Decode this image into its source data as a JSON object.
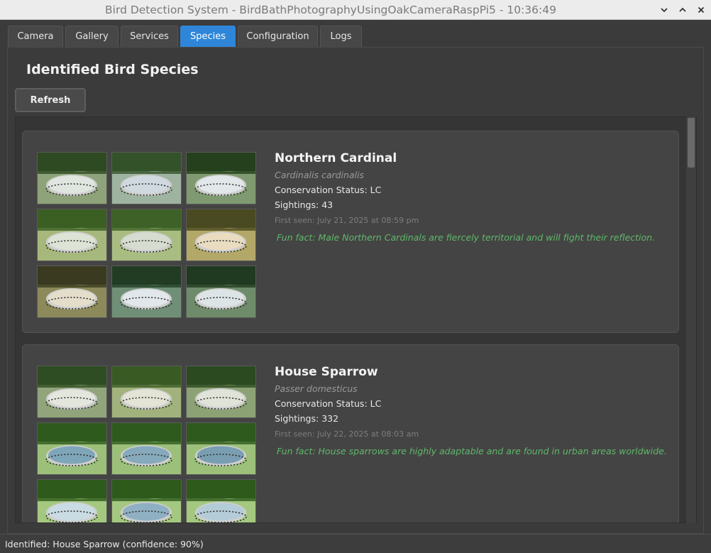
{
  "window": {
    "title": "Bird Detection System - BirdBathPhotographyUsingOakCameraRaspPi5 - 10:36:49",
    "controls": [
      "chevron-down-icon",
      "chevron-up-icon",
      "close-icon"
    ]
  },
  "tabs": [
    {
      "label": "Camera",
      "active": false
    },
    {
      "label": "Gallery",
      "active": false
    },
    {
      "label": "Services",
      "active": false
    },
    {
      "label": "Species",
      "active": true
    },
    {
      "label": "Configuration",
      "active": false
    },
    {
      "label": "Logs",
      "active": false
    }
  ],
  "page": {
    "title": "Identified Bird Species",
    "refresh_label": "Refresh"
  },
  "species": [
    {
      "name": "Northern Cardinal",
      "scientific": "Cardinalis cardinalis",
      "conservation": "Conservation Status: LC",
      "sightings": "Sightings: 43",
      "first_seen": "First seen: July 21, 2025 at 08:59 pm",
      "fun_fact": "Fun fact: Male Northern Cardinals are fiercely territorial and will fight their reflection.",
      "photo_count": 9
    },
    {
      "name": "House Sparrow",
      "scientific": "Passer domesticus",
      "conservation": "Conservation Status: LC",
      "sightings": "Sightings: 332",
      "first_seen": "First seen: July 22, 2025 at 08:03 am",
      "fun_fact": "Fun fact: House sparrows are highly adaptable and are found in urban areas worldwide.",
      "photo_count": 9
    }
  ],
  "status": {
    "text": "Identified: House Sparrow (confidence: 90%)"
  },
  "colors": {
    "accent": "#2f86d8",
    "fun_fact": "#5fb86a",
    "background": "#3b3b3b"
  }
}
